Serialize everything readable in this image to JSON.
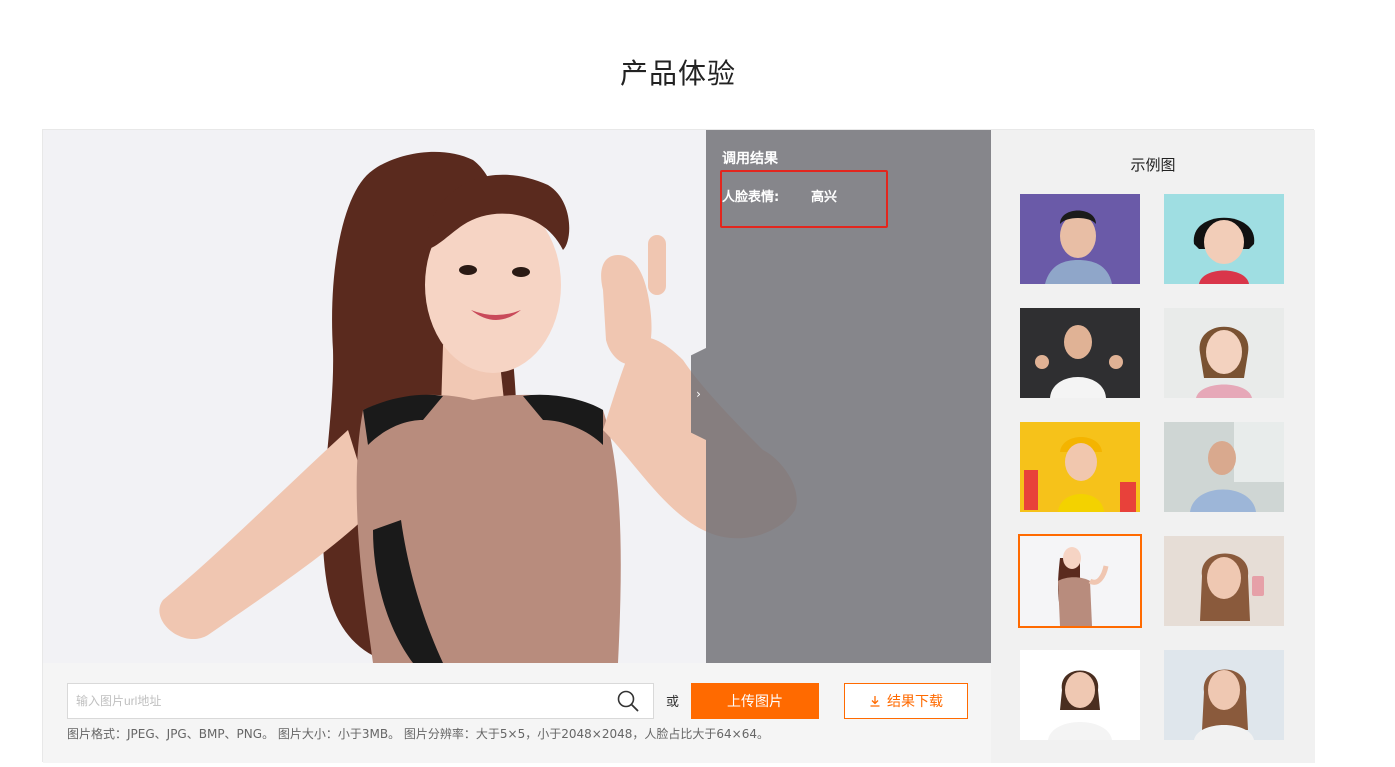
{
  "page": {
    "title": "产品体验"
  },
  "result": {
    "title": "调用结果",
    "label": "人脸表情:",
    "value": "高兴",
    "highlight_color": "#e3261e"
  },
  "controls": {
    "url_placeholder": "输入图片url地址",
    "or_label": "或",
    "upload_label": "上传图片",
    "download_label": "结果下载",
    "hint": "图片格式：JPEG、JPG、BMP、PNG。 图片大小：小于3MB。 图片分辨率：大于5×5，小于2048×2048，人脸占比大于64×64。",
    "accent_color": "#ff6a00"
  },
  "gallery": {
    "title": "示例图",
    "selected_index": 6,
    "items": [
      {
        "name": "example-1",
        "selected": false
      },
      {
        "name": "example-2",
        "selected": false
      },
      {
        "name": "example-3",
        "selected": false
      },
      {
        "name": "example-4",
        "selected": false
      },
      {
        "name": "example-5",
        "selected": false
      },
      {
        "name": "example-6",
        "selected": false
      },
      {
        "name": "example-7",
        "selected": true
      },
      {
        "name": "example-8",
        "selected": false
      },
      {
        "name": "example-9",
        "selected": false
      },
      {
        "name": "example-10",
        "selected": false
      }
    ]
  },
  "icons": {
    "search": "search-icon",
    "download": "download-icon",
    "collapse": "chevron-right-icon"
  }
}
